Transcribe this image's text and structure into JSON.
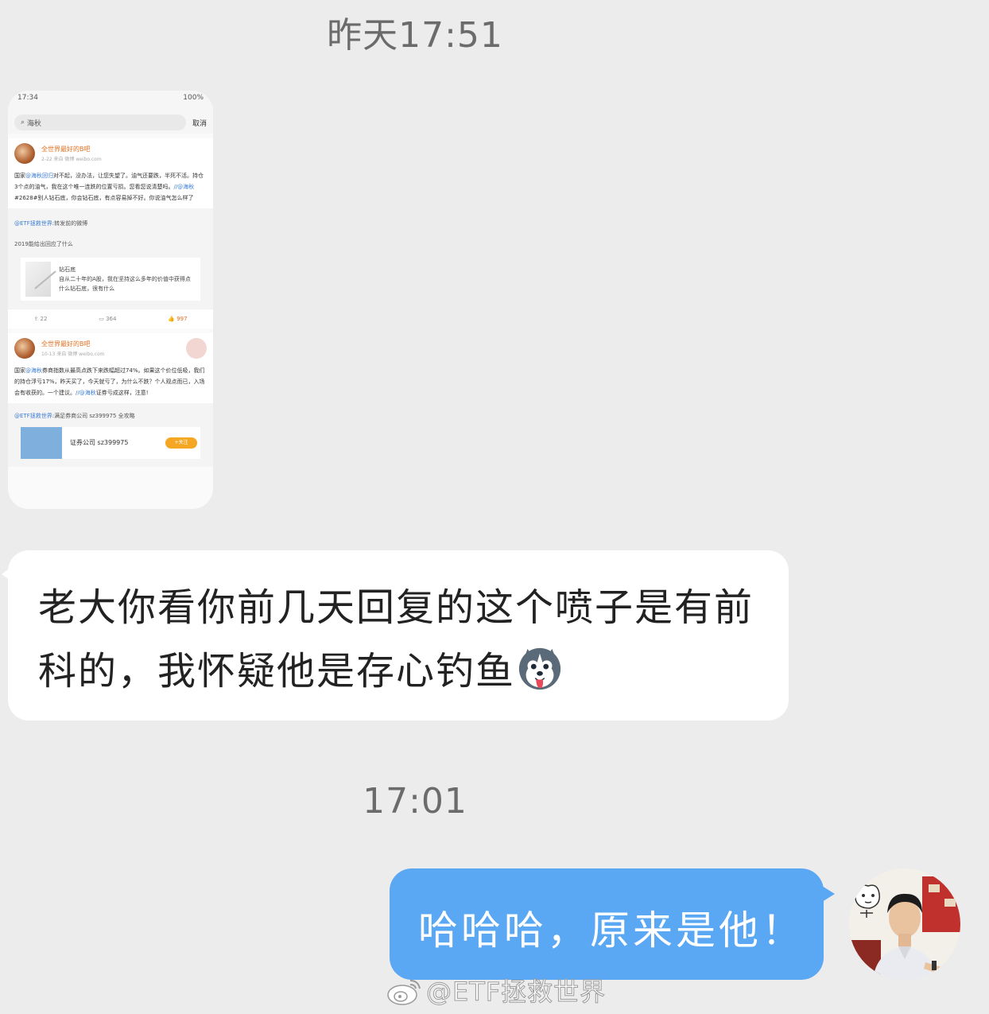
{
  "chat": {
    "timestamp_1": "昨天17:51",
    "timestamp_2": "17:01",
    "incoming_message": "老大你看你前几天回复的这个喷子是有前科的，我怀疑他是存心钓鱼",
    "outgoing_message": "哈哈哈，原来是他！",
    "emoji_icon": "husky-emoji-icon"
  },
  "screenshot_thumb": {
    "status_time": "17:34",
    "status_battery": "100%",
    "search_query": "海秋",
    "cancel_label": "取消",
    "post1": {
      "username": "全世界最好的B吧",
      "meta": "2-22 来自 微博 weibo.com",
      "text_prefix": "国家",
      "mention1": "@海秋回归",
      "text_body": "对不起，没办法，让您失望了。油气还要跌，半死不活。持仓3个点的油气，我在这个唯一连跌的位置亏损。您看您说清楚吗。",
      "mention2": "//@海秋",
      "text_tail": "#2628#别人钻石底，你会钻石底，有点容易掉不好。你说油气怎么样了",
      "repost_mention": "@ETF拯救世界",
      "repost_text": "转发前的微博",
      "repost_line2": "2019能给出回应了什么",
      "card_title": "钻石底",
      "card_text": "自从二十年的A股，我在坚持这么多年的价值中获得点什么钻石底，很有什么",
      "repost_count": "22",
      "comment_count": "364",
      "like_count": "997"
    },
    "post2": {
      "username": "全世界最好的B吧",
      "meta": "10-13 来自 微博 weibo.com",
      "text_prefix": "国家",
      "mention1": "@海秋",
      "text_body": "券商指数从最高点跌下来跌幅超过74%。如果这个价位低吸，我们的持仓浮亏17%，昨天买了，今天就亏了，为什么不跌？个人观点而已，入场会有收获的。一个建议。",
      "mention2": "//@海秋",
      "text_tail": "证券亏成这样，注意!",
      "repost_mention": "@ETF拯救世界",
      "repost_text": "满足券商公司 sz399975  全攻略",
      "stock_name": "证券公司 sz399975",
      "stock_button": "+关注"
    }
  },
  "watermark": {
    "text": "@ETF拯救世界"
  }
}
